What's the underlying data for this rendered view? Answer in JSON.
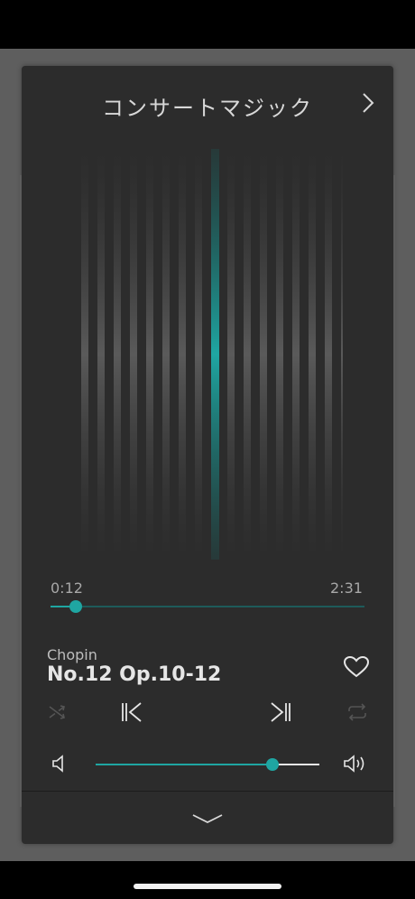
{
  "header": {
    "title": "コンサートマジック"
  },
  "player": {
    "elapsed": "0:12",
    "duration": "2:31",
    "progress": 0.08,
    "artist": "Chopin",
    "title": "No.12 Op.10-12",
    "volume": 0.79,
    "shuffle_enabled": false,
    "repeat_enabled": false
  },
  "icons": {
    "next_page": "chevron-right-icon",
    "favorite": "heart-icon",
    "shuffle": "shuffle-icon",
    "previous": "skip-previous-icon",
    "next": "skip-next-icon",
    "repeat": "repeat-icon",
    "volume_low": "speaker-low-icon",
    "volume_high": "speaker-high-icon",
    "collapse": "chevron-down-icon"
  },
  "colors": {
    "accent": "#1fa6a2",
    "panel": "#2c2c2c",
    "backdrop": "#5e5e5e",
    "text": "#e6e6e6",
    "muted_icon": "#555555"
  }
}
